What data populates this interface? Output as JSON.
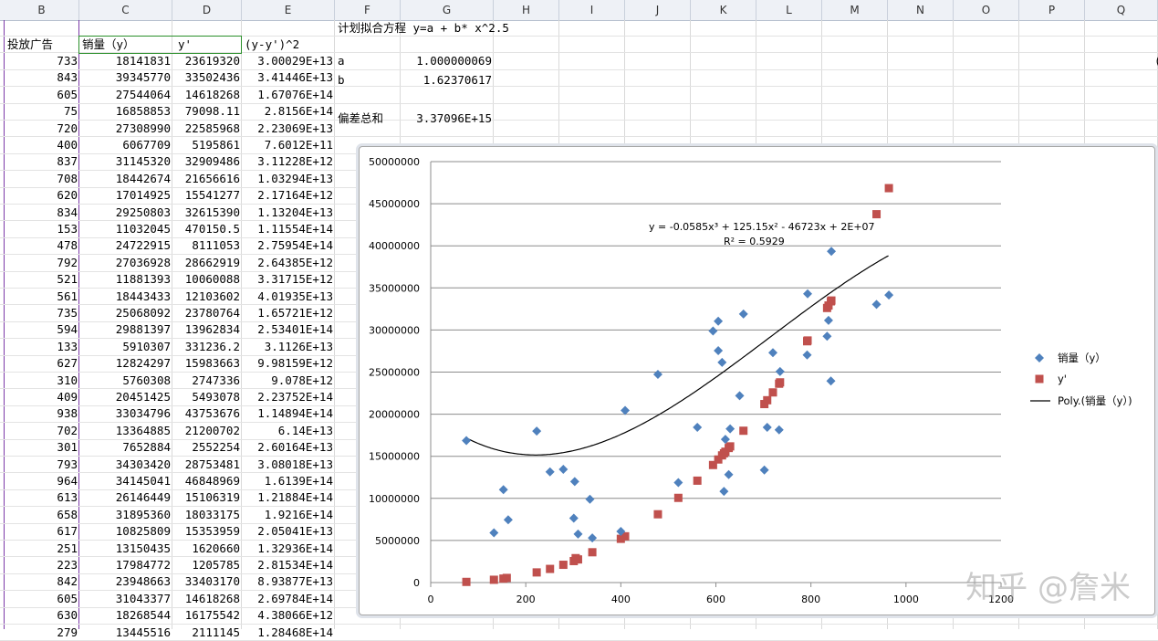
{
  "columns": [
    "B",
    "C",
    "D",
    "E",
    "F",
    "G",
    "H",
    "I",
    "J",
    "K",
    "L",
    "M",
    "N",
    "O",
    "P",
    "Q"
  ],
  "headers": {
    "b": "投放广告",
    "c": "销量（y）",
    "d": "y'",
    "e": "(y-y')^2"
  },
  "fit_note": "计划拟合方程 y=a + b* x^2.5",
  "params": [
    {
      "label": "a",
      "value": "1.000000069"
    },
    {
      "label": "b",
      "value": "1.62370617"
    },
    {
      "label": "",
      "value": ""
    },
    {
      "label": "偏差总和",
      "value": "3.37096E+15"
    }
  ],
  "q_fragment": "(",
  "rows": [
    [
      "733",
      "18141831",
      "23619320",
      "3.00029E+13"
    ],
    [
      "843",
      "39345770",
      "33502436",
      "3.41446E+13"
    ],
    [
      "605",
      "27544064",
      "14618268",
      "1.67076E+14"
    ],
    [
      "75",
      "16858853",
      "79098.11",
      "2.8156E+14"
    ],
    [
      "720",
      "27308990",
      "22585968",
      "2.23069E+13"
    ],
    [
      "400",
      "6067709",
      "5195861",
      "7.6012E+11"
    ],
    [
      "837",
      "31145320",
      "32909486",
      "3.11228E+12"
    ],
    [
      "708",
      "18442674",
      "21656616",
      "1.03294E+13"
    ],
    [
      "620",
      "17014925",
      "15541277",
      "2.17164E+12"
    ],
    [
      "834",
      "29250803",
      "32615390",
      "1.13204E+13"
    ],
    [
      "153",
      "11032045",
      "470150.5",
      "1.11554E+14"
    ],
    [
      "478",
      "24722915",
      "8111053",
      "2.75954E+14"
    ],
    [
      "792",
      "27036928",
      "28662919",
      "2.64385E+12"
    ],
    [
      "521",
      "11881393",
      "10060088",
      "3.31715E+12"
    ],
    [
      "561",
      "18443433",
      "12103602",
      "4.01935E+13"
    ],
    [
      "735",
      "25068092",
      "23780764",
      "1.65721E+12"
    ],
    [
      "594",
      "29881397",
      "13962834",
      "2.53401E+14"
    ],
    [
      "133",
      "5910307",
      "331236.2",
      "3.1126E+13"
    ],
    [
      "627",
      "12824297",
      "15983663",
      "9.98159E+12"
    ],
    [
      "310",
      "5760308",
      "2747336",
      "9.078E+12"
    ],
    [
      "409",
      "20451425",
      "5493078",
      "2.23752E+14"
    ],
    [
      "938",
      "33034796",
      "43753676",
      "1.14894E+14"
    ],
    [
      "702",
      "13364885",
      "21200702",
      "6.14E+13"
    ],
    [
      "301",
      "7652884",
      "2552254",
      "2.60164E+13"
    ],
    [
      "793",
      "34303420",
      "28753481",
      "3.08018E+13"
    ],
    [
      "964",
      "34145041",
      "46848969",
      "1.6139E+14"
    ],
    [
      "613",
      "26146449",
      "15106319",
      "1.21884E+14"
    ],
    [
      "658",
      "31895360",
      "18033175",
      "1.9216E+14"
    ],
    [
      "617",
      "10825809",
      "15353959",
      "2.05041E+13"
    ],
    [
      "251",
      "13150435",
      "1620660",
      "1.32936E+14"
    ],
    [
      "223",
      "17984772",
      "1205785",
      "2.81534E+14"
    ],
    [
      "842",
      "23948663",
      "33403170",
      "8.93877E+13"
    ],
    [
      "605",
      "31043377",
      "14618268",
      "2.69784E+14"
    ],
    [
      "630",
      "18268544",
      "16175542",
      "4.38066E+12"
    ],
    [
      "279",
      "13445516",
      "2111145",
      "1.28468E+14"
    ]
  ],
  "colors": {
    "series1": "#4f81bd",
    "series2": "#c0504d",
    "trend": "#000000"
  },
  "chart_data": {
    "type": "scatter",
    "xlim": [
      0,
      1200
    ],
    "ylim": [
      0,
      50000000
    ],
    "x_ticks": [
      0,
      200,
      400,
      600,
      800,
      1000,
      1200
    ],
    "y_ticks": [
      0,
      5000000,
      10000000,
      15000000,
      20000000,
      25000000,
      30000000,
      35000000,
      40000000,
      45000000,
      50000000
    ],
    "grid": "horizontal",
    "legend_position": "right",
    "equation": "y = -0.0585x³ + 125.15x² - 46723x + 2E+07",
    "r_squared": "R² = 0.5929",
    "series": [
      {
        "name": "销量（y）",
        "marker": "diamond",
        "color": "#4f81bd",
        "points": [
          [
            733,
            18141831
          ],
          [
            843,
            39345770
          ],
          [
            605,
            27544064
          ],
          [
            75,
            16858853
          ],
          [
            720,
            27308990
          ],
          [
            400,
            6067709
          ],
          [
            837,
            31145320
          ],
          [
            708,
            18442674
          ],
          [
            620,
            17014925
          ],
          [
            834,
            29250803
          ],
          [
            153,
            11032045
          ],
          [
            478,
            24722915
          ],
          [
            792,
            27036928
          ],
          [
            521,
            11881393
          ],
          [
            561,
            18443433
          ],
          [
            735,
            25068092
          ],
          [
            594,
            29881397
          ],
          [
            133,
            5910307
          ],
          [
            627,
            12824297
          ],
          [
            310,
            5760308
          ],
          [
            409,
            20451425
          ],
          [
            938,
            33034796
          ],
          [
            702,
            13364885
          ],
          [
            301,
            7652884
          ],
          [
            793,
            34303420
          ],
          [
            964,
            34145041
          ],
          [
            613,
            26146449
          ],
          [
            658,
            31895360
          ],
          [
            617,
            10825809
          ],
          [
            251,
            13150435
          ],
          [
            223,
            17984772
          ],
          [
            842,
            23948663
          ],
          [
            605,
            31043377
          ],
          [
            630,
            18268544
          ],
          [
            279,
            13445516
          ],
          [
            163,
            7450000
          ],
          [
            303,
            12000000
          ],
          [
            340,
            5300000
          ],
          [
            335,
            9900000
          ],
          [
            650,
            22200000
          ]
        ]
      },
      {
        "name": "y'",
        "marker": "square",
        "color": "#c0504d",
        "points": [
          [
            733,
            23619320
          ],
          [
            843,
            33502436
          ],
          [
            605,
            14618268
          ],
          [
            75,
            79098
          ],
          [
            720,
            22585968
          ],
          [
            400,
            5195861
          ],
          [
            837,
            32909486
          ],
          [
            708,
            21656616
          ],
          [
            620,
            15541277
          ],
          [
            834,
            32615390
          ],
          [
            153,
            470150
          ],
          [
            478,
            8111053
          ],
          [
            792,
            28662919
          ],
          [
            521,
            10060088
          ],
          [
            561,
            12103602
          ],
          [
            735,
            23780764
          ],
          [
            594,
            13962834
          ],
          [
            133,
            331236
          ],
          [
            627,
            15983663
          ],
          [
            310,
            2747336
          ],
          [
            409,
            5493078
          ],
          [
            938,
            43753676
          ],
          [
            702,
            21200702
          ],
          [
            301,
            2552254
          ],
          [
            793,
            28753481
          ],
          [
            964,
            46848969
          ],
          [
            613,
            15106319
          ],
          [
            658,
            18033175
          ],
          [
            617,
            15353959
          ],
          [
            251,
            1620660
          ],
          [
            223,
            1205785
          ],
          [
            842,
            33403170
          ],
          [
            630,
            16175542
          ],
          [
            279,
            2111145
          ],
          [
            160,
            550000
          ],
          [
            340,
            3600000
          ],
          [
            305,
            2900000
          ]
        ]
      }
    ],
    "trendline": {
      "name": "Poly.(销量（y）)",
      "coefficients": [
        20000000,
        -46723,
        125.15,
        -0.0585
      ],
      "x_range": [
        75,
        964
      ]
    }
  },
  "watermark": "知乎 @詹米"
}
